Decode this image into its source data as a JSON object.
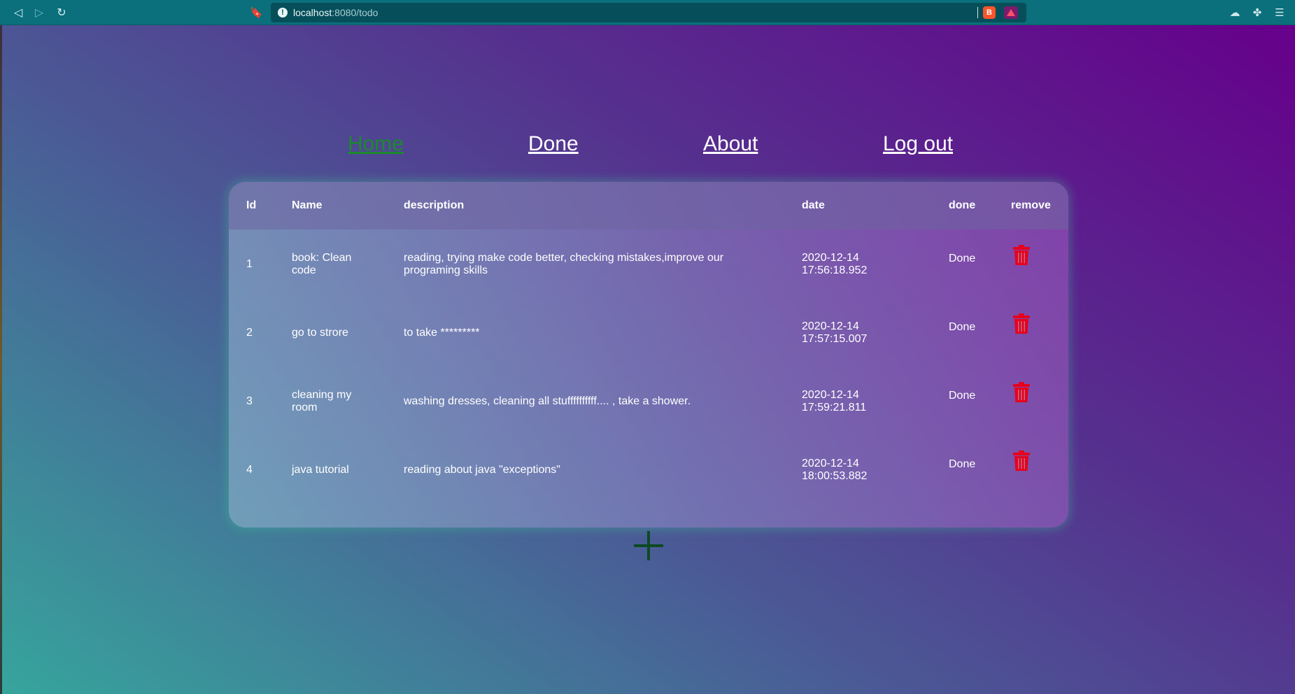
{
  "browser": {
    "url_host": "localhost",
    "url_path": ":8080/todo",
    "back_icon": "back-arrow",
    "forward_icon": "forward-arrow",
    "reload_icon": "reload",
    "bookmark_icon": "bookmark",
    "info_icon": "info",
    "shield_icon": "brave-shield",
    "rewards_icon": "brave-rewards",
    "extensions_icon": "puzzle",
    "menu_icon": "hamburger"
  },
  "nav": {
    "items": [
      {
        "label": "Home",
        "active": true
      },
      {
        "label": "Done",
        "active": false
      },
      {
        "label": "About",
        "active": false
      },
      {
        "label": "Log out",
        "active": false
      }
    ],
    "active_color": "#1a8a2d",
    "link_color": "#ffffff"
  },
  "table": {
    "headers": {
      "id": "Id",
      "name": "Name",
      "description": "description",
      "date": "date",
      "done": "done",
      "remove": "remove"
    },
    "rows": [
      {
        "id": "1",
        "name_l1": "book: Clean",
        "name_l2": "code",
        "desc_l1": "reading, trying make code better, checking mistakes,improve our",
        "desc_l2": "programing skills",
        "date_l1": "2020-12-14",
        "date_l2": "17:56:18.952",
        "done": "Done"
      },
      {
        "id": "2",
        "name_l1": "go to strore",
        "name_l2": "",
        "desc_l1": "to take *********",
        "desc_l2": "",
        "date_l1": "2020-12-14",
        "date_l2": "17:57:15.007",
        "done": "Done"
      },
      {
        "id": "3",
        "name_l1": "cleaning my",
        "name_l2": "room",
        "desc_l1": "washing dresses, cleaning all stuffffffffff.... , take a shower.",
        "desc_l2": "",
        "date_l1": "2020-12-14",
        "date_l2": "17:59:21.811",
        "done": "Done"
      },
      {
        "id": "4",
        "name_l1": "java tutorial",
        "name_l2": "",
        "desc_l1": "reading about java \"exceptions\"",
        "desc_l2": "",
        "date_l1": "2020-12-14",
        "date_l2": "18:00:53.882",
        "done": "Done"
      }
    ],
    "trash_color": "#e8001c"
  },
  "add_icon": "plus",
  "add_color": "#0d4a26"
}
